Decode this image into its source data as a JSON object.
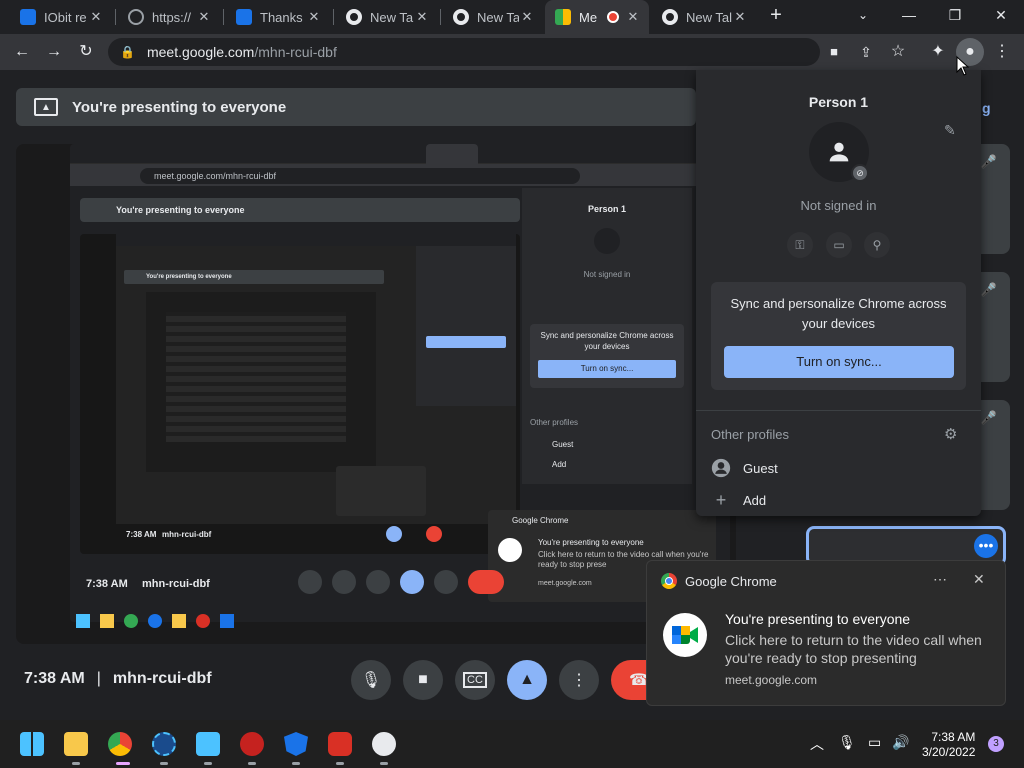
{
  "tabs": [
    {
      "label": "IObit re",
      "favicon_color": "#1a73e8"
    },
    {
      "label": "https://",
      "favicon_color": "#9aa0a6"
    },
    {
      "label": "Thanks",
      "favicon_color": "#1a73e8"
    },
    {
      "label": "New Tal",
      "favicon_color": "#e8eaed"
    },
    {
      "label": "New Tal",
      "favicon_color": "#e8eaed"
    },
    {
      "label": "Me",
      "favicon_color": "#34a853",
      "active": true
    },
    {
      "label": "New Tal",
      "favicon_color": "#e8eaed"
    }
  ],
  "toolbar": {
    "url_domain": "meet.google.com",
    "url_path": "/mhn-rcui-dbf"
  },
  "meet": {
    "present_banner": "You're presenting to everyone",
    "time": "7:38 AM",
    "separator": "|",
    "meeting_code": "mhn-rcui-dbf",
    "side_letter": "g"
  },
  "profile_menu": {
    "name": "Person 1",
    "status": "Not signed in",
    "sync_message": "Sync and personalize Chrome across your devices",
    "sync_button": "Turn on sync...",
    "other_profiles_label": "Other profiles",
    "guest_label": "Guest",
    "add_label": "Add"
  },
  "notification": {
    "app": "Google Chrome",
    "title": "You're presenting to everyone",
    "body": "Click here to return to the video call when you're ready to stop presenting",
    "source": "meet.google.com"
  },
  "mini_screen": {
    "present_banner": "You're presenting to everyone",
    "url": "meet.google.com/mhn-rcui-dbf",
    "time": "7:38 AM",
    "meeting_code": "mhn-rcui-dbf",
    "person": "Person 1",
    "status": "Not signed in",
    "sync_message": "Sync and personalize Chrome across your devices",
    "sync_button": "Turn on sync...",
    "other_profiles_label": "Other profiles",
    "guest_label": "Guest",
    "add_label": "Add",
    "notif_app": "Google Chrome",
    "notif_title": "You're presenting to everyone",
    "notif_body": "Click here to return to the video call when you're ready to stop prese",
    "notif_source": "meet.google.com"
  },
  "taskbar": {
    "time": "7:38 AM",
    "date": "3/20/2022",
    "notification_count": "3"
  }
}
